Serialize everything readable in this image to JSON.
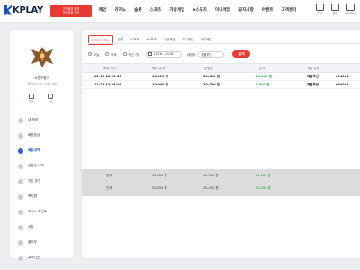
{
  "header": {
    "brand": "KPLAY",
    "notice_line1": "고객센터 문의",
    "notice_line2": "카카오톡 상담",
    "nav": [
      "메인",
      "카지노",
      "슬롯",
      "스포츠",
      "가상게임",
      "e스포츠",
      "미니게임",
      "공지사항",
      "이벤트",
      "고객센터"
    ],
    "icons": [
      {
        "name": "mail-icon",
        "label": "쪽지"
      },
      {
        "name": "bell-icon",
        "label": "알림"
      },
      {
        "name": "settings-icon",
        "label": "마이페이지"
      }
    ]
  },
  "sidebar": {
    "rank_name": "브론즈랭크",
    "rank_sub": "게임머니 보너스 0.5% 적용",
    "quick": [
      {
        "label": "입금"
      },
      {
        "label": "출금"
      }
    ],
    "menu": [
      {
        "label": "내 정보",
        "active": false
      },
      {
        "label": "회원등급",
        "active": false
      },
      {
        "label": "베팅내역",
        "active": true
      },
      {
        "label": "입출금 내역",
        "active": false
      },
      {
        "label": "지인 추천",
        "active": false
      },
      {
        "label": "쪽지함",
        "active": false
      },
      {
        "label": "보너스 포인트",
        "active": false
      },
      {
        "label": "쿠폰",
        "active": false
      },
      {
        "label": "출석부",
        "active": false
      },
      {
        "label": "로그아웃",
        "active": false
      }
    ]
  },
  "tabs": [
    "라이브 카지노",
    "슬롯",
    "스포츠",
    "e스포츠",
    "가상게임",
    "미니게임",
    "캐쉬게임"
  ],
  "active_tab": 0,
  "filters": {
    "radios": [
      "오늘",
      "어제",
      "지난 7일"
    ],
    "date_range": "12/16 - 12/16",
    "provider_label": "제공사",
    "provider_value": "에볼루션",
    "search_label": "검색"
  },
  "table": {
    "headers": [
      "베팅 시간",
      "베팅 금액",
      "당첨금",
      "손익",
      "게임 유형"
    ],
    "rows": [
      {
        "time": "12-16 12:25:30",
        "bet": "10,000 원",
        "win": "20,000 원",
        "profit": "10,000 원",
        "game": "에볼루션",
        "ref": "6940d1"
      },
      {
        "time": "12-16 12:25:04",
        "bet": "20,000 원",
        "win": "20,000 원",
        "profit": "0,000 원",
        "game": "에볼루션",
        "ref": "6940d1"
      }
    ],
    "summary": [
      {
        "label": "합계",
        "bet": "30,000 원",
        "win": "40,000 원",
        "profit": "10,000 원"
      },
      {
        "label": "전체",
        "bet": "30,000 원",
        "win": "40,000 원",
        "profit": "10,000 원"
      }
    ]
  },
  "colors": {
    "accent": "#e73a33",
    "brand": "#1d4fbf",
    "profit": "#1a9e3f",
    "active_menu": "#2d5fd3"
  }
}
